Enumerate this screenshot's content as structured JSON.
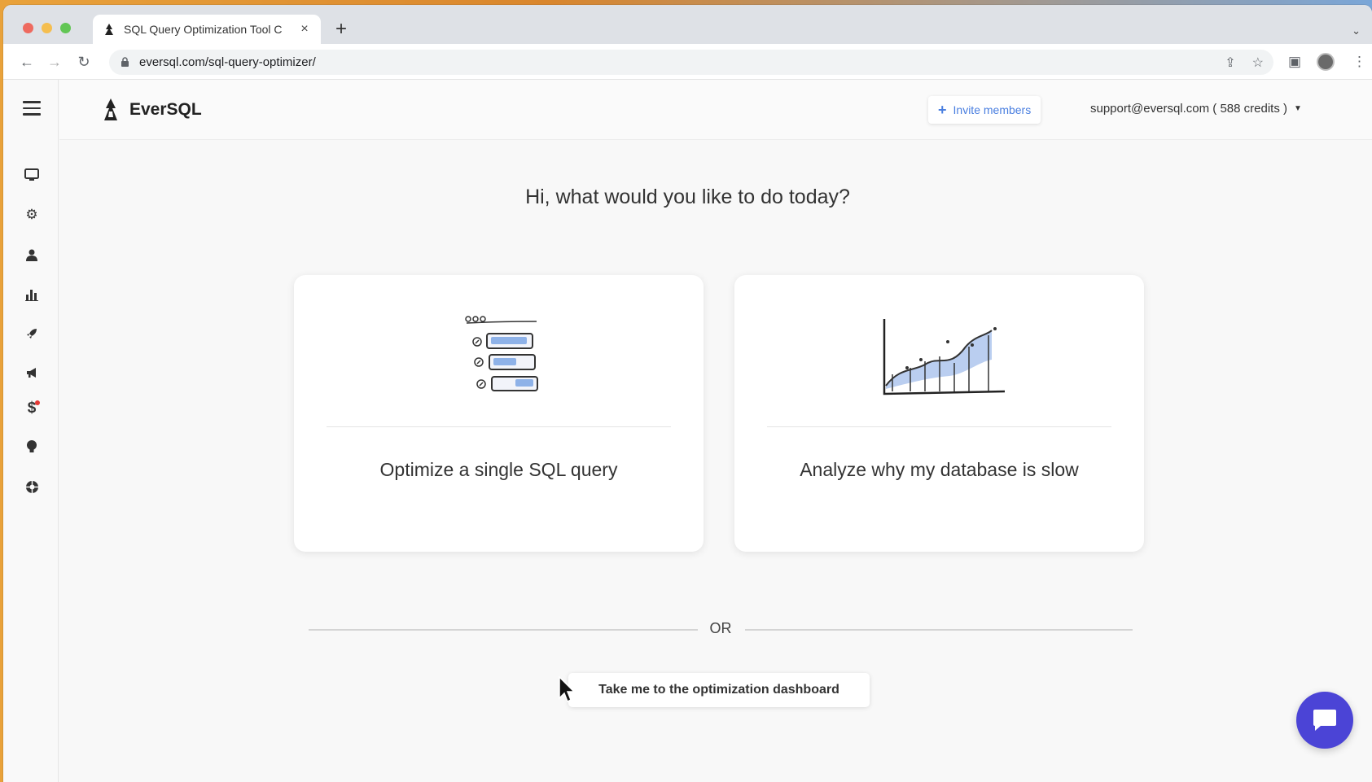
{
  "browser": {
    "tab_title": "SQL Query Optimization Tool C",
    "tab_close": "×",
    "new_tab": "+",
    "url": "eversql.com/sql-query-optimizer/"
  },
  "app": {
    "brand": "EverSQL",
    "invite_label": "Invite members",
    "account_label": "support@eversql.com ( 588 credits )",
    "greeting": "Hi, what would you like to do today?",
    "cards": [
      {
        "label": "Optimize a single SQL query"
      },
      {
        "label": "Analyze why my database is slow"
      }
    ],
    "or_label": "OR",
    "dashboard_label": "Take me to the optimization dashboard"
  },
  "sidebar": {
    "icons": [
      "monitor-icon",
      "gear-icon",
      "user-icon",
      "bar-chart-icon",
      "rocket-icon",
      "megaphone-icon",
      "dollar-icon",
      "lightbulb-icon",
      "lifebuoy-icon"
    ]
  },
  "colors": {
    "accent": "#4a7fe0",
    "chat": "#4b44d6"
  }
}
